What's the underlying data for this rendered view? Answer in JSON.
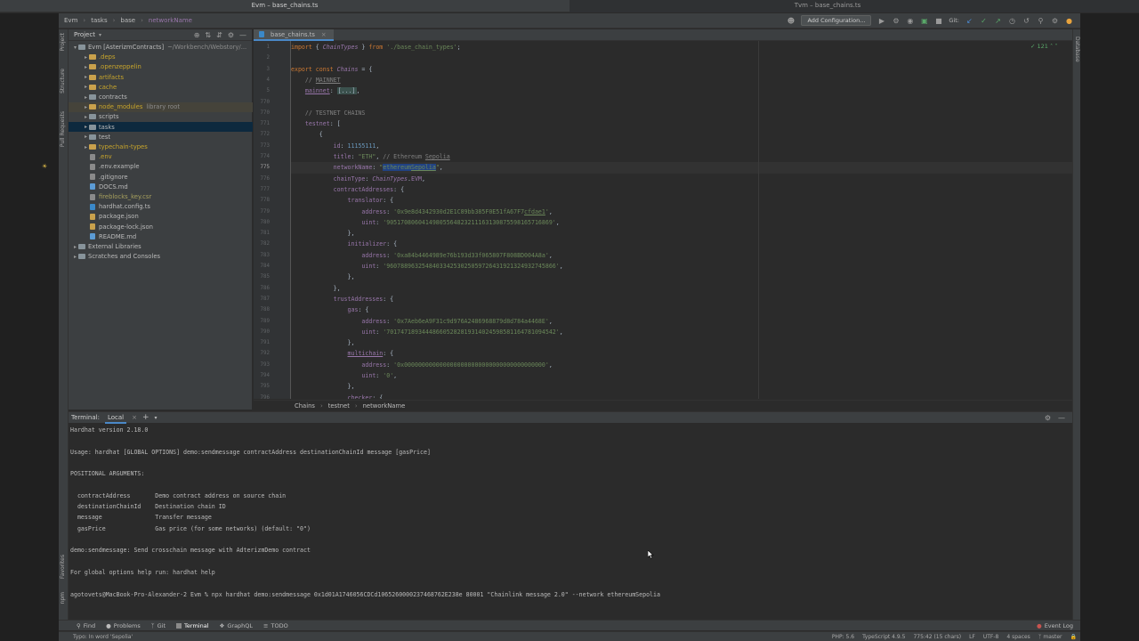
{
  "window": {
    "title_left": "Evm – base_chains.ts",
    "title_right": "Tvm – base_chains.ts"
  },
  "navbar": {
    "crumbs": [
      "Evm",
      "tasks",
      "base",
      "networkName"
    ],
    "add_configuration": "Add Configuration...",
    "git_label": "Git:"
  },
  "project": {
    "title": "Project",
    "tree": [
      {
        "label": "Evm [AsterizmContracts]",
        "suffix": "~/Workbench/Webstory/...",
        "type": "root"
      },
      {
        "label": ".deps",
        "type": "folder",
        "color": "c-yellow"
      },
      {
        "label": ".openzeppelin",
        "type": "folder",
        "color": "c-yellow"
      },
      {
        "label": "artifacts",
        "type": "folder",
        "color": "c-yellow"
      },
      {
        "label": "cache",
        "type": "folder",
        "color": "c-yellow"
      },
      {
        "label": "contracts",
        "type": "folder",
        "color": ""
      },
      {
        "label": "node_modules",
        "suffix": "library root",
        "type": "folder-hl",
        "color": "c-yellow"
      },
      {
        "label": "scripts",
        "type": "folder",
        "color": ""
      },
      {
        "label": "tasks",
        "type": "folder-sel",
        "color": ""
      },
      {
        "label": "test",
        "type": "folder",
        "color": ""
      },
      {
        "label": "typechain-types",
        "type": "folder",
        "color": "c-yellow"
      },
      {
        "label": ".env",
        "type": "file",
        "color": "c-yellow"
      },
      {
        "label": ".env.example",
        "type": "file",
        "color": ""
      },
      {
        "label": ".gitignore",
        "type": "file",
        "color": ""
      },
      {
        "label": "DOCS.md",
        "type": "file-md",
        "color": ""
      },
      {
        "label": "fireblocks_key.csr",
        "type": "file",
        "color": "c-olive"
      },
      {
        "label": "hardhat.config.ts",
        "type": "file-ts",
        "color": ""
      },
      {
        "label": "package.json",
        "type": "file-json",
        "color": ""
      },
      {
        "label": "package-lock.json",
        "type": "file-json",
        "color": ""
      },
      {
        "label": "README.md",
        "type": "file-md",
        "color": ""
      },
      {
        "label": "External Libraries",
        "type": "lib",
        "color": ""
      },
      {
        "label": "Scratches and Consoles",
        "type": "lib",
        "color": ""
      }
    ]
  },
  "editor": {
    "tab": "base_chains.ts",
    "problems_count": "121",
    "lines": [
      {
        "n": "1",
        "html": "<span class='kw'>import</span> { <span class='cls'>ChainTypes</span> } <span class='kw'>from</span> <span class='str'>'./base_chain_types'</span>;"
      },
      {
        "n": "2",
        "html": ""
      },
      {
        "n": "3",
        "html": "<span class='kw'>export const</span> <span class='cls'>Chains</span> = {"
      },
      {
        "n": "4",
        "html": "    <span class='cmt'>// <u>MAINNET</u></span>"
      },
      {
        "n": "5",
        "html": "    <span class='prop'><u>mainnet</u></span>: <span class='fold'>[...]</span>,"
      },
      {
        "n": "770",
        "html": ""
      },
      {
        "n": "770",
        "html": "    <span class='cmt'>// TESTNET CHAINS</span>"
      },
      {
        "n": "771",
        "html": "    <span class='prop'>testnet</span>: ["
      },
      {
        "n": "772",
        "html": "        {"
      },
      {
        "n": "773",
        "html": "            <span class='prop'>id</span>: <span class='num'>11155111</span>,"
      },
      {
        "n": "774",
        "html": "            <span class='prop'>title</span>: <span class='str'>\"ETH\"</span>, <span class='cmt'>// Ethereum <u>Sepolia</u></span>"
      },
      {
        "n": "775",
        "html": "            <span class='prop'>networkName</span>: <span class='str'>\"<span class='sel'>ethereum<u>Sepolia</u></span>\"</span>,",
        "current": true
      },
      {
        "n": "776",
        "html": "            <span class='prop'>chainType</span>: <span class='cls'>ChainTypes</span>.<span class='prop'>EVM</span>,"
      },
      {
        "n": "777",
        "html": "            <span class='prop'>contractAddresses</span>: {"
      },
      {
        "n": "778",
        "html": "                <span class='prop'>translator</span>: {"
      },
      {
        "n": "779",
        "html": "                    <span class='prop'>address</span>: <span class='str'>'0x9e8d4342930d2E1C89bb385F0E51fA67F7<u>cfdae1</u>'</span>,"
      },
      {
        "n": "780",
        "html": "                    <span class='prop'>uint</span>: <span class='str'>'90517080604149805564823211163130875598165716869'</span>,"
      },
      {
        "n": "781",
        "html": "                },"
      },
      {
        "n": "782",
        "html": "                <span class='prop'>initializer</span>: {"
      },
      {
        "n": "783",
        "html": "                    <span class='prop'>address</span>: <span class='str'>'0xa84b4464989e76b193d33f065807F808BD004A8a'</span>,"
      },
      {
        "n": "784",
        "html": "                    <span class='prop'>uint</span>: <span class='str'>'960788963254840334253025059726431921324932745866'</span>,"
      },
      {
        "n": "785",
        "html": "                },"
      },
      {
        "n": "786",
        "html": "            },"
      },
      {
        "n": "787",
        "html": "            <span class='prop'>trustAddresses</span>: {"
      },
      {
        "n": "788",
        "html": "                <span class='prop'>gas</span>: {"
      },
      {
        "n": "789",
        "html": "                    <span class='prop'>address</span>: <span class='str'>'0x7Aeb6eA9F31c9d976A2486968879d8d784a4468E'</span>,"
      },
      {
        "n": "790",
        "html": "                    <span class='prop'>uint</span>: <span class='str'>'701747189344486605282819314024598581164781094542'</span>,"
      },
      {
        "n": "791",
        "html": "                },"
      },
      {
        "n": "792",
        "html": "                <span class='prop'><u>multichain</u></span>: {"
      },
      {
        "n": "793",
        "html": "                    <span class='prop'>address</span>: <span class='str'>'0x0000000000000000000000000000000000000000'</span>,"
      },
      {
        "n": "794",
        "html": "                    <span class='prop'>uint</span>: <span class='str'>'0'</span>,"
      },
      {
        "n": "795",
        "html": "                },"
      },
      {
        "n": "796",
        "html": "                <span class='prop'>checker</span>: {"
      }
    ],
    "breadcrumb": [
      "Chains",
      "testnet",
      "networkName"
    ]
  },
  "terminal": {
    "title": "Terminal:",
    "tab": "Local",
    "lines": [
      "Hardhat version 2.18.0",
      "",
      "Usage: hardhat [GLOBAL OPTIONS] demo:sendmessage contractAddress destinationChainId message [gasPrice]",
      "",
      "POSITIONAL ARGUMENTS:",
      "",
      "  contractAddress       Demo contract address on source chain",
      "  destinationChainId    Destination chain ID",
      "  message               Transfer message",
      "  gasPrice              Gas price (for some networks) (default: \"0\")",
      "",
      "demo:sendmessage: Send crosschain message with AdterizmDemo contract",
      "",
      "For global options help run: hardhat help",
      "",
      "agotovets@MacBook-Pro-Alexander-2 Evm % npx hardhat demo:sendmessage 0x1d01A1746056CDCd1065260000237468762E238e 80001 \"Chainlink message 2.0\" --network ethereumSepolia"
    ]
  },
  "toolwindows": {
    "find": "Find",
    "problems": "Problems",
    "git": "Git",
    "terminal": "Terminal",
    "graphql": "GraphQL",
    "todo": "TODO",
    "event_log": "Event Log"
  },
  "statusbar": {
    "message": "Typo: In word 'Sepolia'",
    "php": "PHP: 5.6",
    "ts": "TypeScript 4.9.5",
    "pos": "775:42 (15 chars)",
    "lf": "LF",
    "enc": "UTF-8",
    "indent": "4 spaces",
    "branch": "master"
  },
  "strips": {
    "project": "Project",
    "structure": "Structure",
    "pull": "Pull Requests",
    "favorites": "Favorites",
    "npm": "npm",
    "database": "Database"
  }
}
